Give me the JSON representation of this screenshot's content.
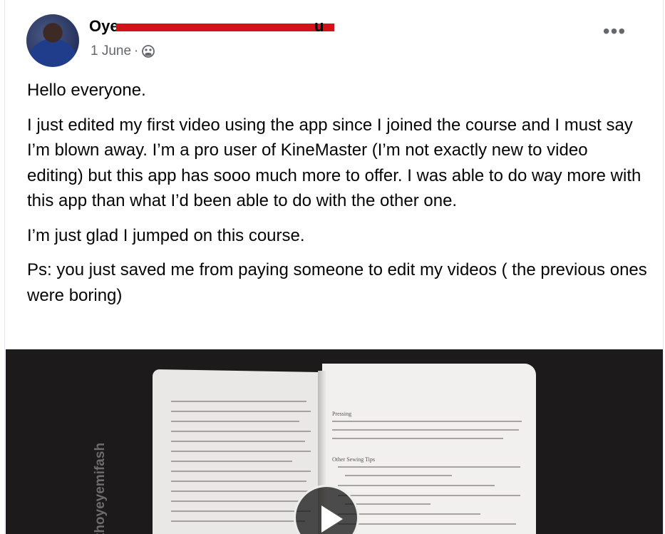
{
  "post": {
    "author_visible": "Oye",
    "author_tail": "u",
    "date": "1 June",
    "separator": "·",
    "audience_icon": "globe-icon",
    "more_icon": "more-options-icon",
    "more_label": "•••",
    "paragraphs": [
      "Hello everyone.",
      "I just edited my first video using the app since I joined the course and I must say I’m blown away. I’m a pro user of KineMaster  (I’m not exactly new to video editing) but this app has sooo much more to offer. I was able to do way more with this app than what I’d been able to do with the other one.",
      "I’m just glad I jumped on this course.",
      "Ps: you just saved me from paying someone to edit my videos ( the previous ones were boring)"
    ]
  },
  "media": {
    "watermark": "thoyeyemifash",
    "right_page_heading_1": "Pressing",
    "right_page_heading_2": "Other Sewing Tips",
    "play_icon": "play-icon"
  },
  "colors": {
    "redaction": "#d4111b",
    "secondary_text": "#65676b",
    "media_background": "#1c1a1a"
  }
}
